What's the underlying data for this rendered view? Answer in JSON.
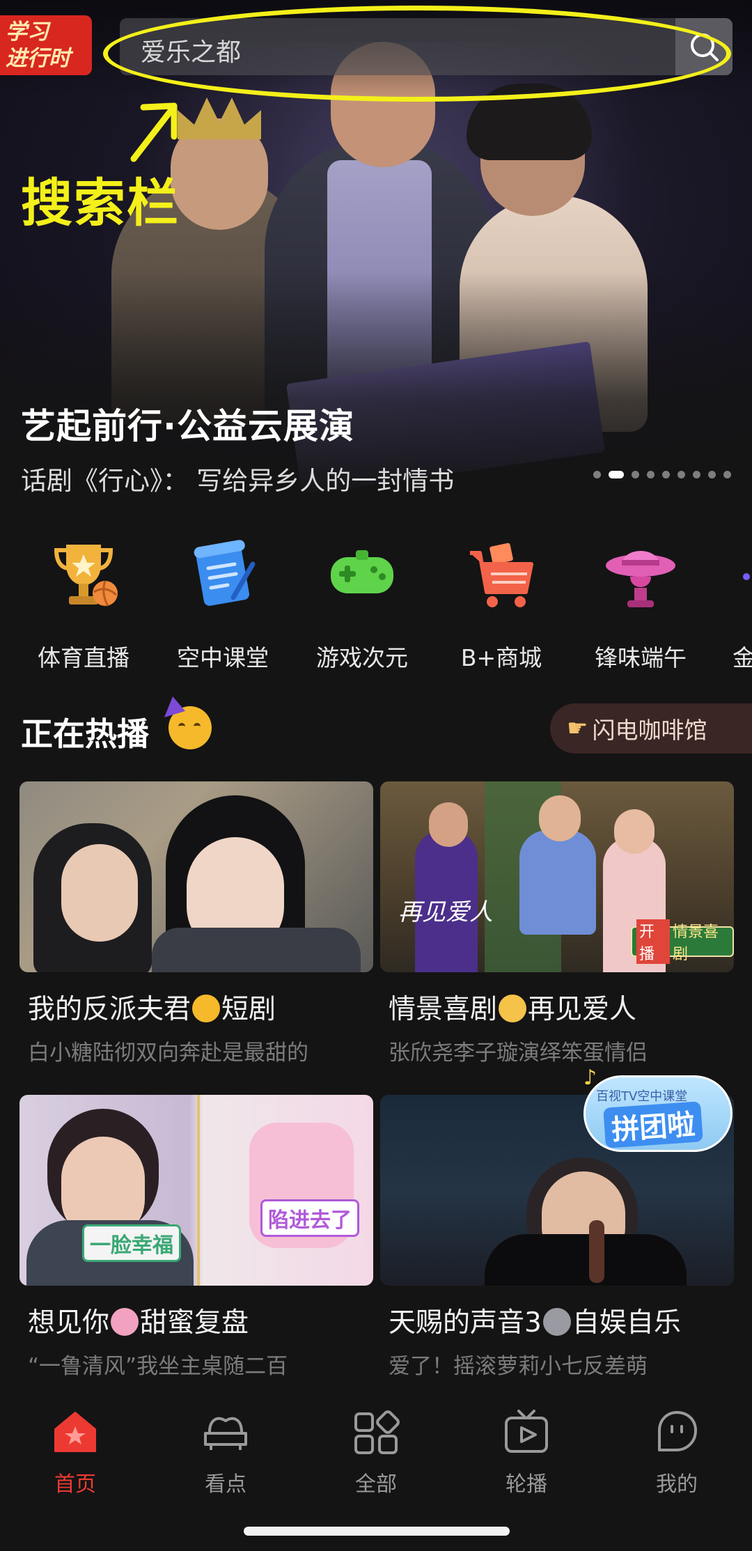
{
  "header": {
    "logo_line1": "学习",
    "logo_line2": "进行时",
    "search_placeholder": "爱乐之都",
    "annotation_label": "搜索栏"
  },
  "banner": {
    "title": "艺起前行·公益云展演",
    "subtitle": "话剧《行心》： 写给异乡人的一封情书",
    "page_count": 9,
    "active_index": 1
  },
  "categories": [
    {
      "label": "体育直播",
      "icon": "trophy-icon"
    },
    {
      "label": "空中课堂",
      "icon": "scroll-icon"
    },
    {
      "label": "游戏次元",
      "icon": "gamepad-icon"
    },
    {
      "label": "B+商城",
      "icon": "shopping-cart-icon"
    },
    {
      "label": "锋味端午",
      "icon": "hat-icon"
    },
    {
      "label": "金",
      "icon": "partial-icon"
    }
  ],
  "section": {
    "title": "正在热播",
    "title_emoji": "party-face-icon",
    "promo_label": "闪电咖啡馆",
    "promo_icon": "pointing-hand-icon"
  },
  "cards": [
    {
      "title_a": "我的反派夫君",
      "title_b": "短剧",
      "emoji": "smiling-hearts-icon",
      "subtitle": "白小糖陆彻双向奔赴是最甜的"
    },
    {
      "title_a": "情景喜剧",
      "title_b": "再见爱人",
      "emoji": "waving-hand-icon",
      "subtitle": "张欣尧李子璇演绎笨蛋情侣",
      "thumb_caption": "再见爱人",
      "thumb_badge_a": "开播",
      "thumb_badge_b": "情景喜剧"
    },
    {
      "title_a": "想见你",
      "title_b": "甜蜜复盘",
      "emoji": "couple-heart-icon",
      "subtitle": "“一鲁清风”我坐主桌随二百",
      "thumb_sticker_a": "一脸幸福",
      "thumb_sticker_b": "陷进去了"
    },
    {
      "title_a": "天赐的声音3",
      "title_b": "自娱自乐",
      "emoji": "microphone-icon",
      "subtitle": "爱了！摇滚萝莉小七反差萌",
      "thumb_badge_top": "百视TV空中课堂",
      "thumb_badge_main": "拼团啦"
    }
  ],
  "tabs": [
    {
      "label": "首页",
      "icon": "home-icon",
      "active": true
    },
    {
      "label": "看点",
      "icon": "sofa-icon",
      "active": false
    },
    {
      "label": "全部",
      "icon": "grid-icon",
      "active": false
    },
    {
      "label": "轮播",
      "icon": "tv-play-icon",
      "active": false
    },
    {
      "label": "我的",
      "icon": "profile-icon",
      "active": false
    }
  ],
  "colors": {
    "accent": "#ec3a33",
    "annotation": "#f4f01a",
    "background": "#141414"
  }
}
